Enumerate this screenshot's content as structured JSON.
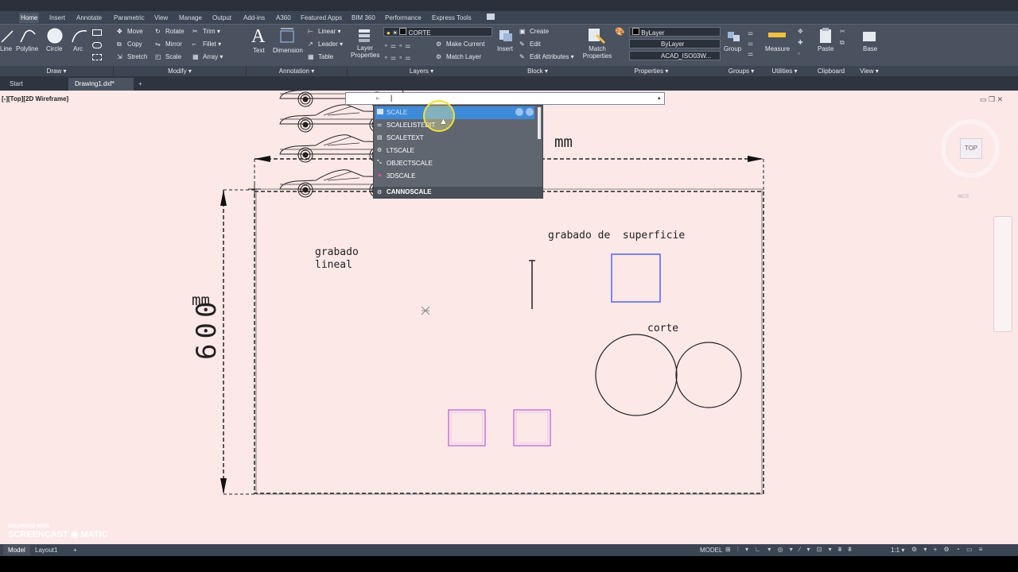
{
  "ribbon_tabs": [
    "Home",
    "Insert",
    "Annotate",
    "Parametric",
    "View",
    "Manage",
    "Output",
    "Add-ins",
    "A360",
    "Featured Apps",
    "BIM 360",
    "Performance",
    "Express Tools"
  ],
  "draw": {
    "line": "Line",
    "polyline": "Polyline",
    "circle": "Circle",
    "arc": "Arc",
    "title": "Draw ▾"
  },
  "modify": {
    "move": "Move",
    "rotate": "Rotate",
    "trim": "Trim ▾",
    "copy": "Copy",
    "mirror": "Mirror",
    "fillet": "Fillet ▾",
    "stretch": "Stretch",
    "scale": "Scale",
    "array": "Array ▾",
    "title": "Modify ▾"
  },
  "annotation": {
    "text": "Text",
    "dimension": "Dimension",
    "linear": "Linear ▾",
    "leader": "Leader ▾",
    "table": "Table",
    "title": "Annotation ▾"
  },
  "layers": {
    "layer_properties": "Layer Properties",
    "current_layer": "CORTE",
    "make_current": "Make Current",
    "match_layer": "Match Layer",
    "title": "Layers ▾"
  },
  "block": {
    "insert": "Insert",
    "create": "Create",
    "edit": "Edit",
    "edit_attributes": "Edit Attributes ▾",
    "title": "Block ▾"
  },
  "properties": {
    "match": "Match Properties",
    "color": "ByLayer",
    "linetype": "ByLayer",
    "lineweight": "ACAD_ISO03W...",
    "title": "Properties ▾"
  },
  "groups": {
    "group": "Group",
    "title": "Groups ▾"
  },
  "utilities": {
    "measure": "Measure",
    "title": "Utilities ▾"
  },
  "clipboard": {
    "paste": "Paste",
    "title": "Clipboard"
  },
  "view": {
    "base": "Base",
    "title": "View ▾"
  },
  "file_tabs": [
    "Start",
    "Drawing1.dxf*"
  ],
  "new_tab": "+",
  "viewport_label": "[-][Top][2D Wireframe]",
  "command": {
    "prompt": "✕ 🔧 ▸ ·",
    "value": "|"
  },
  "autocomplete": [
    {
      "label": "SCALE",
      "selected": true
    },
    {
      "label": "SCALELISTEDIT"
    },
    {
      "label": "SCALETEXT"
    },
    {
      "label": "LTSCALE"
    },
    {
      "label": "OBJECTSCALE"
    },
    {
      "label": "3DSCALE"
    }
  ],
  "autocomplete_footer": "CANNOSCALE",
  "viewcube": {
    "top": "TOP",
    "wcs": "WCS"
  },
  "drawing": {
    "dim_mm_top": "mm",
    "dim_mm_left": "mm",
    "dim_600": "600",
    "grabado_lineal_1": "grabado",
    "grabado_lineal_2": "lineal",
    "grabado_superficie": "grabado de  superficie",
    "corte": "corte"
  },
  "layout_tabs": [
    "Model",
    "Layout1"
  ],
  "status": {
    "model": "MODEL",
    "scale": "1:1 ▾"
  },
  "watermark": {
    "line1": "RECORDED WITH",
    "line2": "SCREENCAST ◉ MATIC"
  },
  "colors": {
    "selection_blue": "#5b6cf0",
    "magenta": "#c070d0",
    "ribbon": "#4a5260",
    "viewport_bg": "#fde8e8"
  }
}
